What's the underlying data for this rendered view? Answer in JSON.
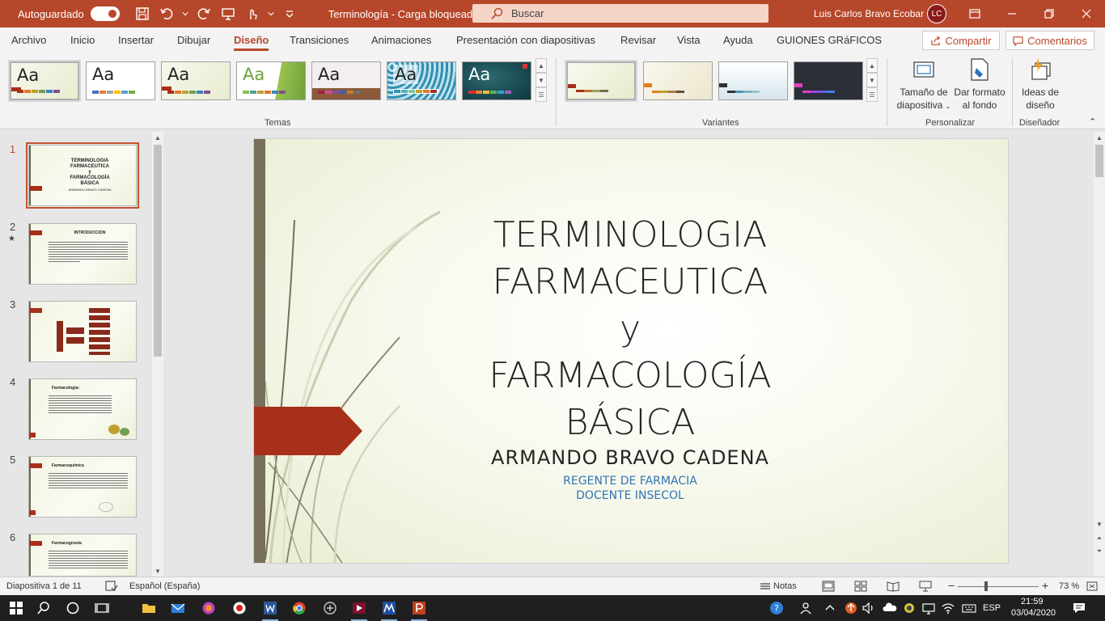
{
  "titlebar": {
    "autosave_label": "Autoguardado",
    "doc_title": "Terminología - Carga bloqueada",
    "search_placeholder": "Buscar",
    "user_name": "Luis Carlos Bravo Ecobar",
    "user_initials": "LC"
  },
  "tabs": [
    "Archivo",
    "Inicio",
    "Insertar",
    "Dibujar",
    "Diseño",
    "Transiciones",
    "Animaciones",
    "Presentación con diapositivas",
    "Revisar",
    "Vista",
    "Ayuda",
    "GUIONES GRáFICOS"
  ],
  "active_tab": "Diseño",
  "actions": {
    "share": "Compartir",
    "comments": "Comentarios"
  },
  "ribbon": {
    "themes_label": "Temas",
    "theme_sample": "Aa",
    "variants_label": "Variantes",
    "customize_label": "Personalizar",
    "designer_label": "Diseñador",
    "slide_size": [
      "Tamaño de",
      "diapositiva"
    ],
    "format_bg": [
      "Dar formato",
      "al fondo"
    ],
    "design_ideas": [
      "Ideas de",
      "diseño"
    ]
  },
  "thumbnails": {
    "numbers": [
      "1",
      "2",
      "3",
      "4",
      "5",
      "6"
    ],
    "star": "★",
    "slide1_title": [
      "TERMINOLOGIA",
      "FARMACEUTICA",
      "y",
      "FARMACOLOGÍA",
      "BÁSICA"
    ],
    "slide1_author": "ARMANDO BRAVO CADENA",
    "slide2_title": "INTRODUCCION",
    "slide4_title": "Farmacología:",
    "slide5_title": "Farmacoquímica",
    "slide6_title": "Farmacognosia"
  },
  "slide": {
    "title_lines": [
      "TERMINOLOGIA",
      "FARMACEUTICA",
      "y",
      "FARMACOLOGÍA",
      "BÁSICA"
    ],
    "author": "ARMANDO BRAVO CADENA",
    "sub1": "REGENTE DE FARMACIA",
    "sub2": "DOCENTE  INSECOL"
  },
  "statusbar": {
    "slide_info": "Diapositiva 1 de 11",
    "language": "Español (España)",
    "notes": "Notas",
    "zoom": "73 %",
    "minus": "−",
    "plus": "+"
  },
  "taskbar": {
    "lang": "ESP",
    "time": "21:59",
    "date": "03/04/2020"
  },
  "colors": {
    "accent": "#b7472a",
    "slide_bar": "#77705a",
    "slide_arrow": "#a8301a",
    "subtitle_blue": "#2e75b6"
  }
}
